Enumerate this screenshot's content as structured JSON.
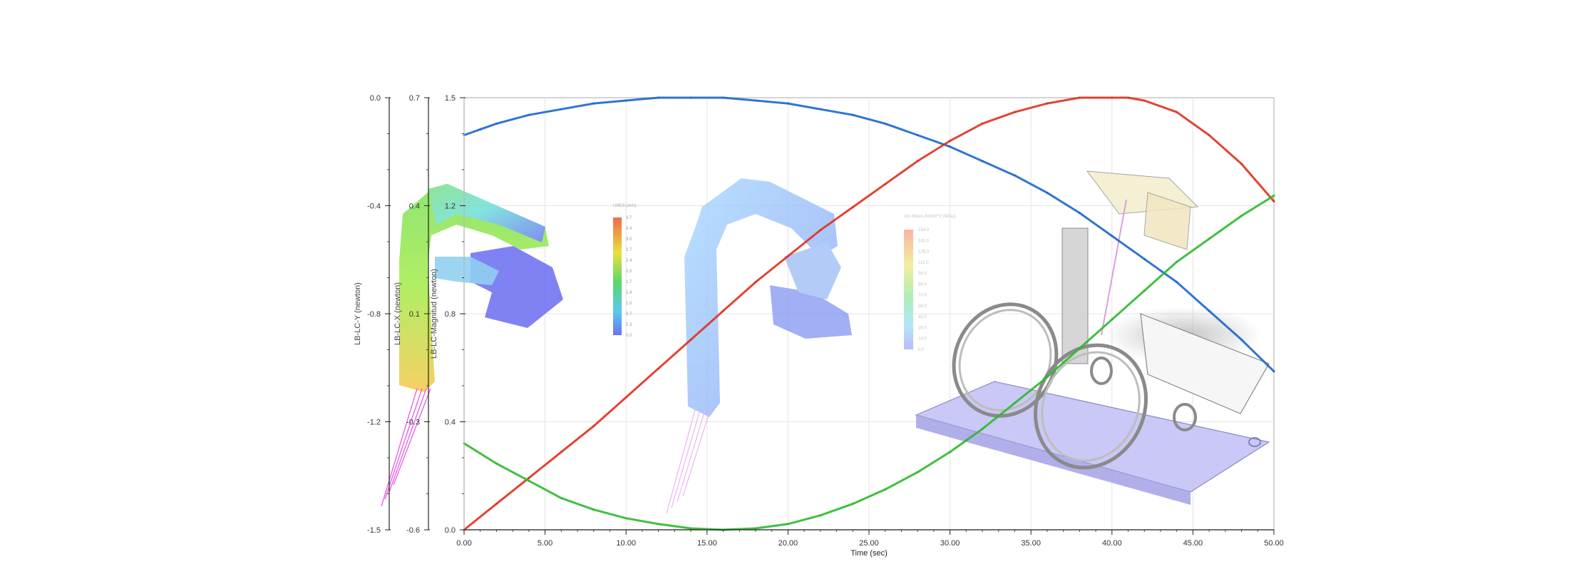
{
  "chart_data": {
    "type": "line",
    "xlabel": "Time (sec)",
    "xlim": [
      0,
      50
    ],
    "xticks": [
      "0.00",
      "5.00",
      "10.00",
      "15.00",
      "20.00",
      "25.00",
      "30.00",
      "35.00",
      "40.00",
      "45.00",
      "50.00"
    ],
    "grid": true,
    "axes": [
      {
        "label": "LB-LC-Y (newton)",
        "range": [
          -1.5,
          0.0
        ],
        "ticks": [
          "0.0",
          "-0.4",
          "-0.8",
          "-1.2",
          "-1.5"
        ]
      },
      {
        "label": "LB-LC-X (newton)",
        "range": [
          -0.6,
          0.7
        ],
        "ticks": [
          "0.7",
          "0.4",
          "0.1",
          "-0.3",
          "-0.6"
        ]
      },
      {
        "label": "LB-LC-Magnitud (newton)",
        "range": [
          0.0,
          1.5
        ],
        "ticks": [
          "1.5",
          "1.2",
          "0.8",
          "0.4",
          "0.0"
        ]
      }
    ],
    "series": [
      {
        "color": "#1a66cc",
        "x": [
          0,
          1,
          2,
          4,
          6,
          8,
          10,
          12,
          14,
          16,
          18,
          20,
          22,
          24,
          26,
          28,
          30,
          32,
          34,
          36,
          38,
          40,
          42,
          44,
          46,
          48,
          50
        ],
        "y": [
          1.37,
          1.39,
          1.41,
          1.44,
          1.46,
          1.48,
          1.49,
          1.5,
          1.5,
          1.5,
          1.49,
          1.48,
          1.46,
          1.44,
          1.41,
          1.37,
          1.33,
          1.28,
          1.23,
          1.17,
          1.1,
          1.02,
          0.94,
          0.86,
          0.76,
          0.66,
          0.55
        ]
      },
      {
        "color": "#e0301e",
        "x": [
          0,
          2,
          4,
          6,
          8,
          10,
          12,
          14,
          16,
          18,
          20,
          22,
          24,
          26,
          28,
          30,
          32,
          34,
          36,
          38,
          40,
          41,
          42,
          44,
          46,
          48,
          50
        ],
        "y": [
          0.0,
          0.09,
          0.18,
          0.27,
          0.36,
          0.46,
          0.56,
          0.66,
          0.76,
          0.86,
          0.95,
          1.04,
          1.12,
          1.2,
          1.28,
          1.35,
          1.41,
          1.45,
          1.48,
          1.5,
          1.5,
          1.5,
          1.49,
          1.45,
          1.37,
          1.27,
          1.14
        ]
      },
      {
        "color": "#2db82d",
        "x": [
          0,
          2,
          4,
          6,
          8,
          10,
          12,
          14,
          16,
          18,
          20,
          22,
          24,
          26,
          28,
          30,
          32,
          34,
          36,
          38,
          40,
          42,
          44,
          46,
          48,
          50
        ],
        "y": [
          0.3,
          0.23,
          0.17,
          0.11,
          0.07,
          0.04,
          0.02,
          0.005,
          0.0,
          0.005,
          0.02,
          0.05,
          0.09,
          0.14,
          0.2,
          0.27,
          0.35,
          0.44,
          0.53,
          0.63,
          0.73,
          0.83,
          0.93,
          1.01,
          1.09,
          1.16
        ]
      }
    ],
    "overlay_legend_1": {
      "title": "URES (mm)",
      "values": [
        "3.7",
        "3.4",
        "3.0",
        "2.7",
        "2.4",
        "2.0",
        "1.7",
        "1.4",
        "1.0",
        "0.7",
        "0.3",
        "0.0"
      ]
    },
    "overlay_legend_2": {
      "title": "von Mises (N/mm^2 (MPa))",
      "values": [
        "154.0",
        "140.0",
        "126.0",
        "112.0",
        "98.0",
        "84.0",
        "70.0",
        "56.0",
        "42.0",
        "28.0",
        "14.0",
        "0.0"
      ]
    }
  }
}
